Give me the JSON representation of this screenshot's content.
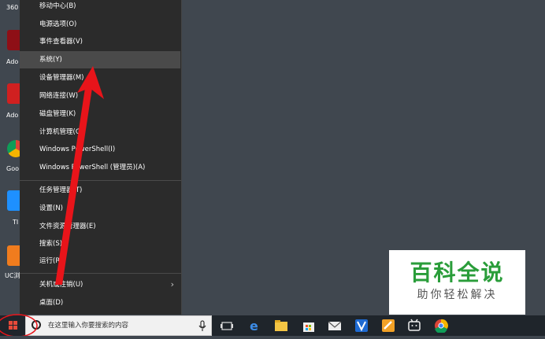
{
  "desktop_icons": [
    {
      "label": "360",
      "icon": "app-icon",
      "color": "#3a7bd5"
    },
    {
      "label": "Ado Acrob",
      "icon": "acrobat-icon",
      "color": "#b3121b"
    },
    {
      "label": "Ado Crea",
      "icon": "creative-cloud-icon",
      "color": "#d02020"
    },
    {
      "label": "Goo Chro",
      "icon": "chrome-icon",
      "color": "#2e9f4a"
    },
    {
      "label": "TI",
      "icon": "app-icon",
      "color": "#1e90ff"
    },
    {
      "label": "UC浏",
      "icon": "uc-browser-icon",
      "color": "#f07c1e"
    }
  ],
  "menu": {
    "items": [
      {
        "label": "移动中心(B)"
      },
      {
        "label": "电源选项(O)"
      },
      {
        "label": "事件查看器(V)"
      },
      {
        "label": "系统(Y)"
      },
      {
        "label": "设备管理器(M)"
      },
      {
        "label": "网络连接(W)"
      },
      {
        "label": "磁盘管理(K)"
      },
      {
        "label": "计算机管理(G)"
      },
      {
        "label": "Windows PowerShell(I)"
      },
      {
        "label": "Windows PowerShell (管理员)(A)"
      },
      {
        "label": "任务管理器(T)"
      },
      {
        "label": "设置(N)"
      },
      {
        "label": "文件资源管理器(E)"
      },
      {
        "label": "搜索(S)"
      },
      {
        "label": "运行(R)"
      },
      {
        "label": "关机或注销(U)"
      },
      {
        "label": "桌面(D)"
      }
    ],
    "highlighted": "系统(Y)"
  },
  "watermark": {
    "title": "百科全说",
    "subtitle": "助你轻松解决"
  },
  "taskbar": {
    "search_placeholder": "在这里输入你要搜索的内容",
    "icons": [
      "task-view-icon",
      "edge-icon",
      "file-explorer-icon",
      "store-icon",
      "mail-icon",
      "app-icon",
      "app-icon",
      "bilibili-icon",
      "chrome-icon"
    ]
  },
  "colors": {
    "annotation": "#e8141a",
    "watermark_green": "#2a9d3a"
  }
}
